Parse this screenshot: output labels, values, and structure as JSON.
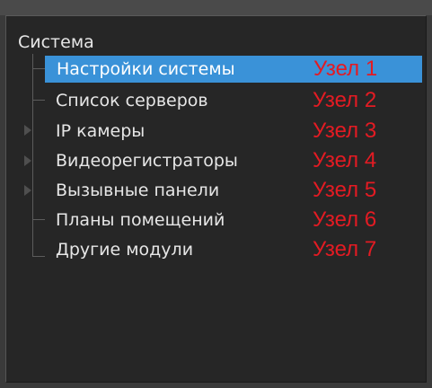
{
  "tree": {
    "root_label": "Система",
    "items": [
      {
        "label": "Настройки системы",
        "node": "Узел 1",
        "selected": true,
        "expandable": false
      },
      {
        "label": "Список серверов",
        "node": "Узел 2",
        "selected": false,
        "expandable": false
      },
      {
        "label": "IP камеры",
        "node": "Узел 3",
        "selected": false,
        "expandable": true
      },
      {
        "label": "Видеорегистраторы",
        "node": "Узел 4",
        "selected": false,
        "expandable": true
      },
      {
        "label": "Вызывные панели",
        "node": "Узел 5",
        "selected": false,
        "expandable": true
      },
      {
        "label": "Планы помещений",
        "node": "Узел 6",
        "selected": false,
        "expandable": false
      },
      {
        "label": "Другие модули",
        "node": "Узел 7",
        "selected": false,
        "expandable": false
      }
    ]
  },
  "colors": {
    "selection": "#3a92d8",
    "node_label": "#e31b23",
    "background": "#262626",
    "text": "#e6e6e6"
  },
  "icons": {
    "expander": "triangle-right-icon"
  }
}
